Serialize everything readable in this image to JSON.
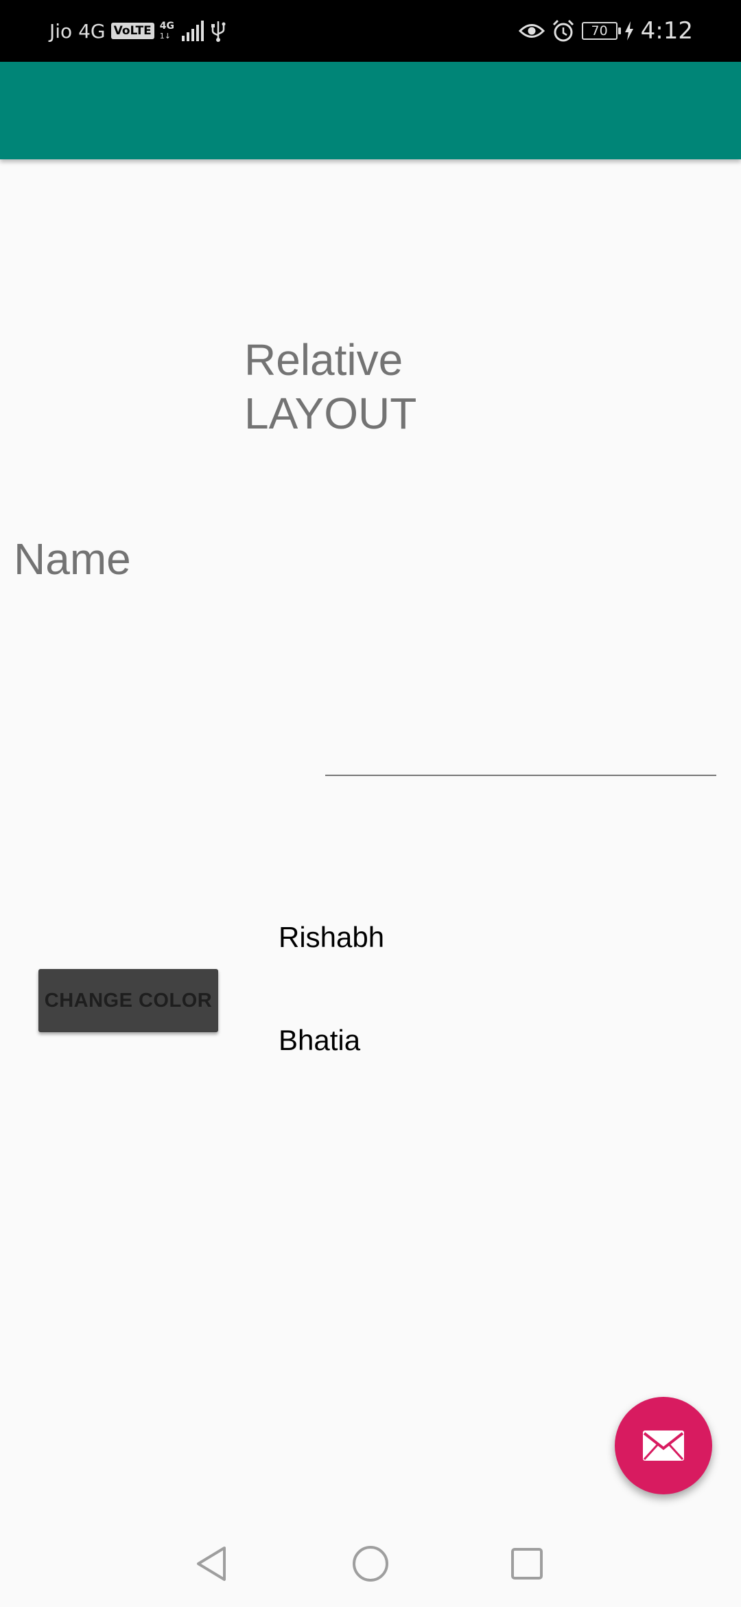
{
  "status_bar": {
    "carrier": "Jio 4G",
    "volte": "VoLTE",
    "network": "4G",
    "network_sub": "1↓",
    "battery": "70",
    "time": "4:12"
  },
  "content": {
    "title_line1": "Relative",
    "title_line2": "LAYOUT",
    "name_label": "Name",
    "name_input_value": "",
    "first_name": "Rishabh",
    "last_name": "Bhatia",
    "change_color_label": "CHANGE COLOR"
  },
  "fab": {
    "icon": "email-icon"
  },
  "nav_bar": {
    "back_icon": "back-icon",
    "home_icon": "home-icon",
    "recents_icon": "recents-icon"
  },
  "colors": {
    "app_bar": "#008577",
    "fab": "#d81b60",
    "button": "#424242",
    "background": "#fafafa"
  }
}
